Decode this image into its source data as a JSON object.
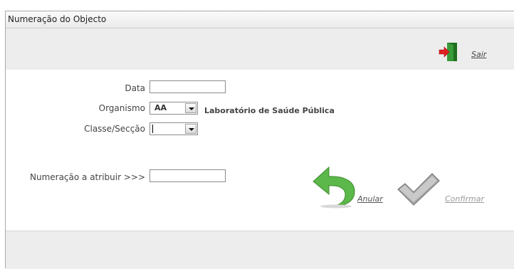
{
  "window": {
    "title": "Numeração do Objecto"
  },
  "toolbar": {
    "exit_label": "Sair"
  },
  "form": {
    "date_label": "Data",
    "date_value": "",
    "organism_label": "Organismo",
    "organism_value": "AA",
    "organism_name": "Laboratório de Saúde Pública",
    "class_label": "Classe/Secção",
    "class_value": "",
    "number_label": "Numeração a atribuir >>>",
    "number_value": ""
  },
  "actions": {
    "cancel_label": "Anular",
    "confirm_label": "Confirmar"
  },
  "colors": {
    "cancel_icon": "#5cb84a",
    "confirm_icon": "#9a9a9a",
    "exit_door": "#2f8a2f",
    "exit_arrow": "#e02020"
  }
}
